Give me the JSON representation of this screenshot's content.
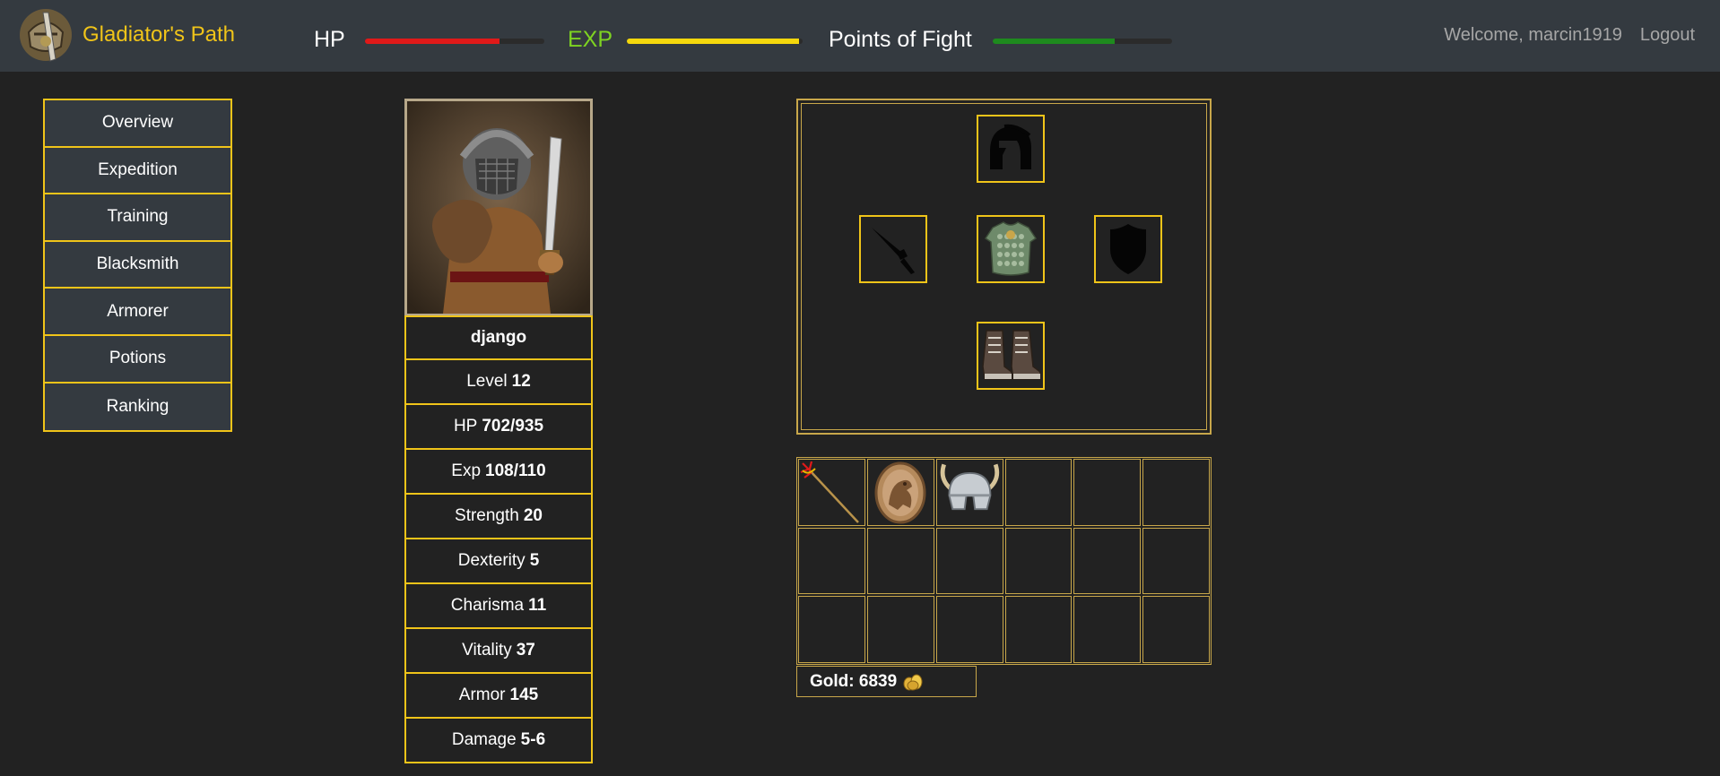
{
  "header": {
    "app_name": "Gladiator's Path",
    "bars": [
      {
        "label": "HP",
        "fill": 0.75,
        "label_color": "#ffffff",
        "fill_color": "#e01919"
      },
      {
        "label": "EXP",
        "fill": 0.98,
        "label_color": "#7ed321",
        "fill_color": "#f5d80c"
      },
      {
        "label": "Points of Fight",
        "fill": 0.68,
        "label_color": "#ffffff",
        "fill_color": "#1e8a1e"
      }
    ],
    "welcome": "Welcome, marcin1919",
    "logout": "Logout"
  },
  "menu": {
    "items": [
      "Overview",
      "Expedition",
      "Training",
      "Blacksmith",
      "Armorer",
      "Potions",
      "Ranking"
    ]
  },
  "character": {
    "name": "django",
    "stats": [
      {
        "label": "Level",
        "value": "12"
      },
      {
        "label": "HP",
        "value": "702/935"
      },
      {
        "label": "Exp",
        "value": "108/110"
      },
      {
        "label": "Strength",
        "value": "20"
      },
      {
        "label": "Dexterity",
        "value": "5"
      },
      {
        "label": "Charisma",
        "value": "11"
      },
      {
        "label": "Vitality",
        "value": "37"
      },
      {
        "label": "Armor",
        "value": "145"
      },
      {
        "label": "Damage",
        "value": "5-6"
      }
    ]
  },
  "equipment": {
    "helmet": "helmet-slot-empty",
    "weapon": "dagger-slot-empty",
    "armor": "scale-armor",
    "shield": "shield-slot-empty",
    "boots": "boots"
  },
  "inventory": {
    "items": [
      "trident",
      "griffin-amulet",
      "horned-helmet"
    ]
  },
  "gold": {
    "label": "Gold: 6839"
  },
  "colors": {
    "accent": "#f0c419",
    "background": "#222222",
    "panel": "#343a40"
  }
}
